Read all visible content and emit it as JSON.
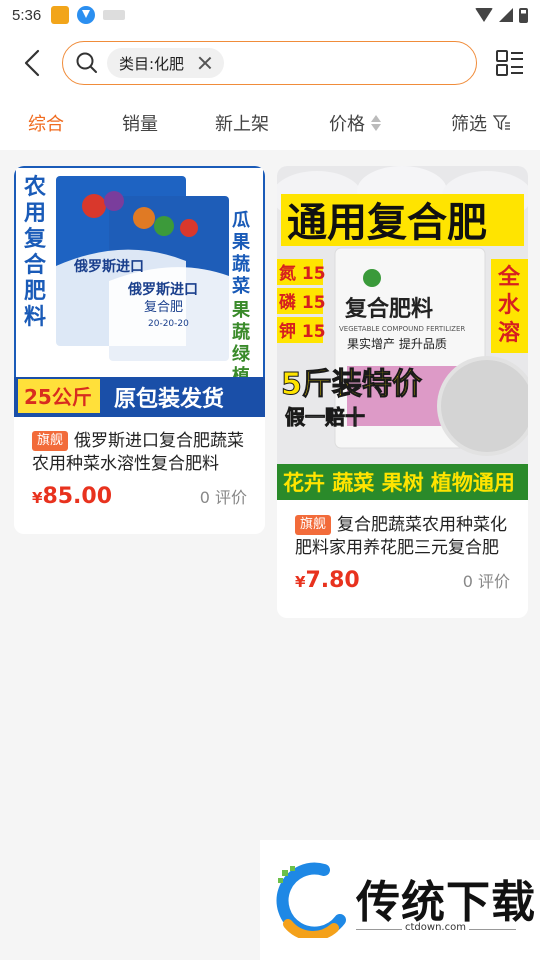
{
  "status_bar": {
    "time": "5:36"
  },
  "search": {
    "chip_label": "类目:化肥"
  },
  "sort_tabs": [
    {
      "label": "综合",
      "active": true
    },
    {
      "label": "销量",
      "active": false
    },
    {
      "label": "新上架",
      "active": false
    },
    {
      "label": "价格",
      "active": false
    },
    {
      "label": "筛选",
      "active": false
    }
  ],
  "products": [
    {
      "badge": "旗舰",
      "title": "俄罗斯进口复合肥蔬菜农用种菜水溶性复合肥料",
      "currency": "¥",
      "price": "85.00",
      "reviews": "0 评价",
      "image": {
        "left_text": "农用复合肥料",
        "right_text_1": "瓜果蔬菜",
        "right_text_2": "果蔬绿植",
        "bag_title": "俄罗斯进口",
        "bag_subtitle": "复合肥",
        "bag_ratio": "20-20-20",
        "weight_tag": "25公斤",
        "banner": "原包装发货"
      }
    },
    {
      "badge": "旗舰",
      "title": "复合肥蔬菜农用种菜化肥料家用养花肥三元复合肥",
      "currency": "¥",
      "price": "7.80",
      "reviews": "0 评价",
      "image": {
        "top_banner": "通用复合肥",
        "nutrients": [
          "氮 15",
          "磷 15",
          "钾 15"
        ],
        "right_tag": "全水溶",
        "bag_title": "复合肥料",
        "bag_en": "VEGETABLE COMPOUND FERTILIZER",
        "bag_slogan": "果实增产 提升品质",
        "promo": "5斤装特价",
        "promo_sub": "假一赔十",
        "bottom_banner": "花卉 蔬菜 果树 植物通用"
      }
    }
  ],
  "watermark": {
    "name": "传统下载",
    "url": "ctdown.com"
  },
  "colors": {
    "accent": "#f06b1f",
    "price": "#e8321e",
    "badge": "#f26b3a"
  }
}
